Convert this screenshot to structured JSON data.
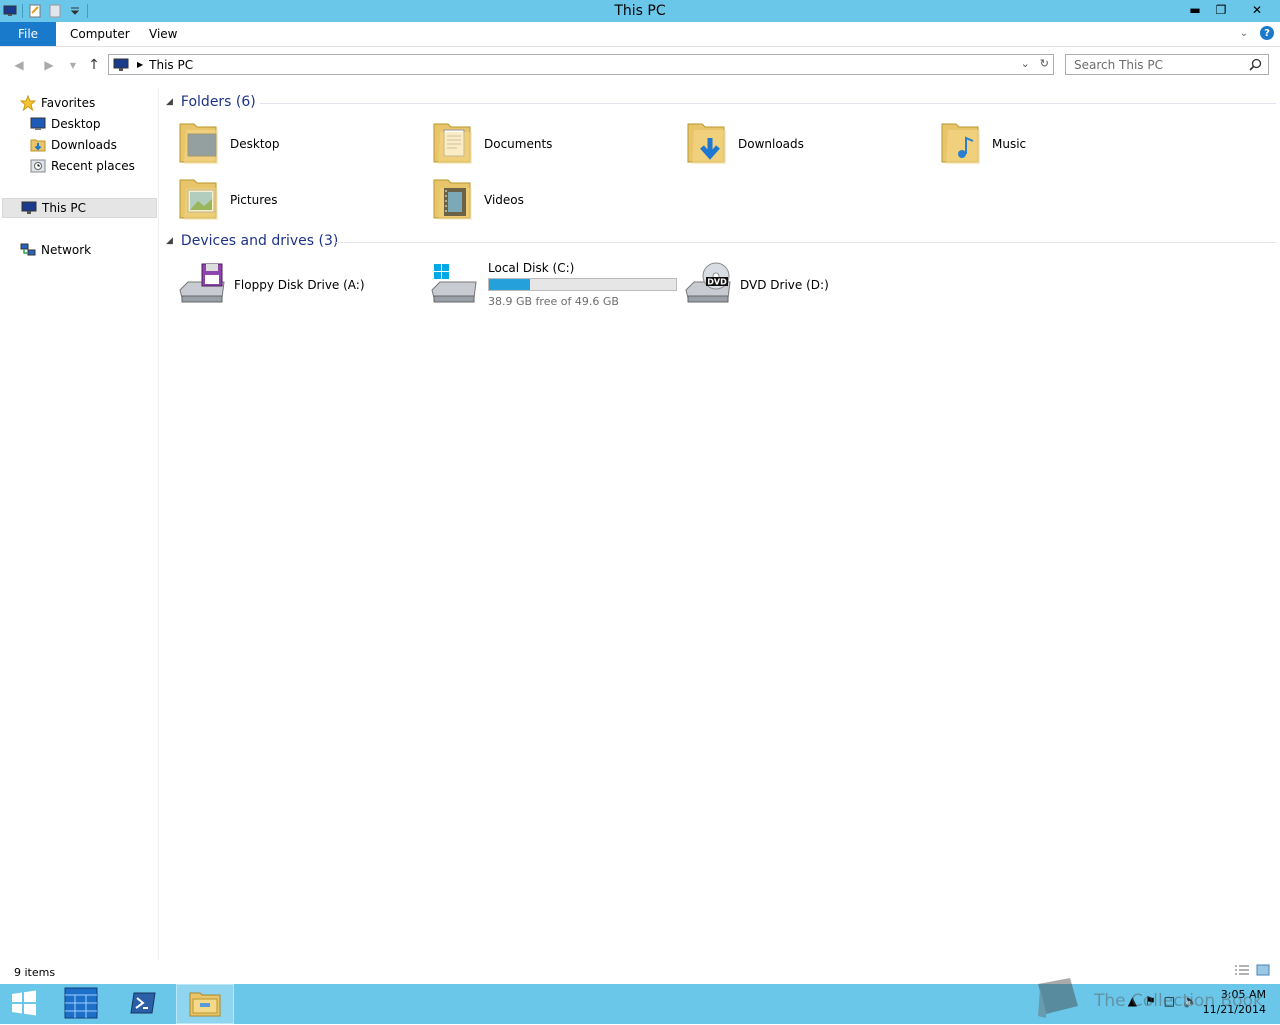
{
  "window": {
    "title": "This PC"
  },
  "ribbon": {
    "tabs": [
      "File",
      "Computer",
      "View"
    ]
  },
  "address": {
    "path": "This PC",
    "search_placeholder": "Search This PC"
  },
  "nav": {
    "favorites": "Favorites",
    "favorites_items": [
      "Desktop",
      "Downloads",
      "Recent places"
    ],
    "this_pc": "This PC",
    "network": "Network"
  },
  "folders": {
    "header": "Folders (6)",
    "items": [
      "Desktop",
      "Documents",
      "Downloads",
      "Music",
      "Pictures",
      "Videos"
    ]
  },
  "devices": {
    "header": "Devices and drives (3)",
    "floppy": "Floppy Disk Drive (A:)",
    "local_disk": {
      "name": "Local Disk (C:)",
      "free": "38.9 GB free of 49.6 GB",
      "used_fraction": 0.22
    },
    "dvd": "DVD Drive (D:)"
  },
  "status": {
    "items": "9 items"
  },
  "taskbar": {
    "time": "3:05 AM",
    "date": "11/21/2014"
  },
  "watermark": {
    "text": "The Collection Book"
  },
  "colors": {
    "title_bar": "#6ac7ea",
    "accent": "#1979ca",
    "group_header": "#1e3287",
    "progress": "#26a0da"
  }
}
